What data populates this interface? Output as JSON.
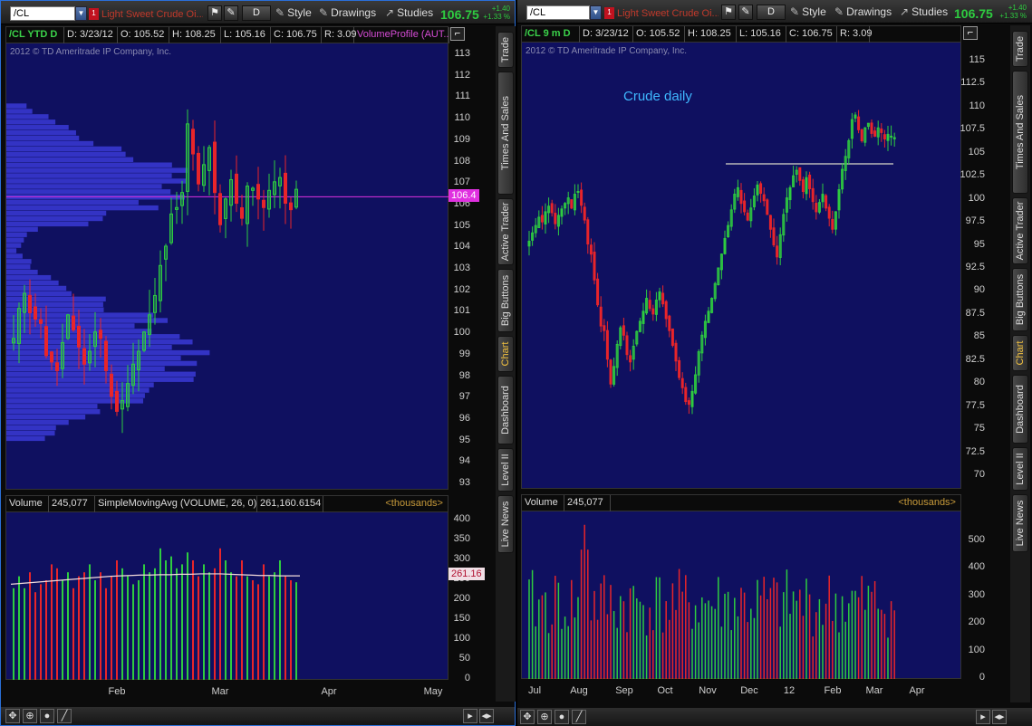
{
  "left": {
    "toolbar": {
      "symbol": "/CL",
      "description": "Light Sweet Crude Oi...",
      "badge": "1",
      "aggregation": "D",
      "style_label": "Style",
      "drawings_label": "Drawings",
      "studies_label": "Studies",
      "last_price": "106.75",
      "change_abs": "+1.40",
      "change_pct": "+1.33 %"
    },
    "header": {
      "symbol_tf": "/CL YTD D",
      "date": "D: 3/23/12",
      "open": "O: 105.52",
      "high": "H: 108.25",
      "low": "L: 105.16",
      "close": "C: 106.75",
      "range": "R: 3.09",
      "study": "VolumeProfile (AUT..."
    },
    "copyright": "2012 © TD Ameritrade IP Company, Inc.",
    "price_axis": [
      "113",
      "112",
      "111",
      "110",
      "109",
      "108",
      "107",
      "106",
      "105",
      "104",
      "103",
      "102",
      "101",
      "100",
      "99",
      "98",
      "97",
      "96",
      "95",
      "94",
      "93"
    ],
    "price_tag": "106.4",
    "volume_header": {
      "label": "Volume",
      "value": "245,077",
      "study": "SimpleMovingAvg (VOLUME, 26, 0)",
      "study_value": "261,160.6154",
      "units": "<thousands>"
    },
    "volume_axis": [
      "400",
      "350",
      "300",
      "250",
      "200",
      "150",
      "100",
      "50",
      "0"
    ],
    "volume_tag": "261.16",
    "time_axis": [
      "Feb",
      "Mar",
      "Apr",
      "May"
    ]
  },
  "right": {
    "toolbar": {
      "symbol": "/CL",
      "description": "Light Sweet Crude Oi...",
      "badge": "1",
      "aggregation": "D",
      "style_label": "Style",
      "drawings_label": "Drawings",
      "studies_label": "Studies",
      "last_price": "106.75",
      "change_abs": "+1.40",
      "change_pct": "+1.33 %"
    },
    "header": {
      "symbol_tf": "/CL 9 m D",
      "date": "D: 3/23/12",
      "open": "O: 105.52",
      "high": "H: 108.25",
      "low": "L: 105.16",
      "close": "C: 106.75",
      "range": "R: 3.09"
    },
    "copyright": "2012 © TD Ameritrade IP Company, Inc.",
    "annotation": "Crude daily",
    "price_axis": [
      "115",
      "112.5",
      "110",
      "107.5",
      "105",
      "102.5",
      "100",
      "97.5",
      "95",
      "92.5",
      "90",
      "87.5",
      "85",
      "82.5",
      "80",
      "77.5",
      "75",
      "72.5",
      "70"
    ],
    "volume_header": {
      "label": "Volume",
      "value": "245,077",
      "units": "<thousands>"
    },
    "volume_axis": [
      "500",
      "400",
      "300",
      "200",
      "100",
      "0"
    ],
    "time_axis": [
      "Jul",
      "Aug",
      "Sep",
      "Oct",
      "Nov",
      "Dec",
      "12",
      "Feb",
      "Mar",
      "Apr"
    ]
  },
  "side_tabs": [
    "Trade",
    "Times And Sales",
    "Active Trader",
    "Big Buttons",
    "Chart",
    "Dashboard",
    "Level II",
    "Live News"
  ],
  "active_tab": "Chart",
  "colors": {
    "chart_bg": "#0f1060",
    "up": "#2ecc40",
    "down": "#e8252a",
    "profile": "#3a3ad6",
    "poc_line": "#e030e0",
    "sma_line": "#f3dada",
    "resistance_line": "#b8b8b8"
  },
  "chart_data": [
    {
      "type": "candlestick",
      "title": "/CL YTD D",
      "ylim": [
        93,
        113.5
      ],
      "x_range": [
        "2012-01-03",
        "2012-05-25"
      ],
      "poc_price": 106.4,
      "closes": [
        99.8,
        101.2,
        101.9,
        101.0,
        100.7,
        100.5,
        99.0,
        98.7,
        98.3,
        99.6,
        100.9,
        100.2,
        99.4,
        98.6,
        99.2,
        100.1,
        99.8,
        98.3,
        97.1,
        96.4,
        96.9,
        97.7,
        98.6,
        99.2,
        100.1,
        100.9,
        101.8,
        103.2,
        104.1,
        105.6,
        105.9,
        106.6,
        109.8,
        108.4,
        107.0,
        107.9,
        108.7,
        106.6,
        105.1,
        106.3,
        107.2,
        106.1,
        105.4,
        106.9,
        106.8,
        106.3,
        105.9,
        106.7,
        107.1,
        107.3,
        106.1,
        105.8,
        106.75
      ],
      "volume_thousands": [
        230,
        260,
        230,
        270,
        220,
        240,
        250,
        290,
        280,
        250,
        270,
        230,
        260,
        270,
        290,
        250,
        270,
        230,
        260,
        300,
        280,
        260,
        240,
        250,
        290,
        270,
        280,
        330,
        300,
        310,
        280,
        290,
        320,
        300,
        260,
        290,
        270,
        280,
        330,
        300,
        270,
        260,
        300,
        260,
        250,
        240,
        290,
        260,
        270,
        300,
        260,
        250,
        245
      ],
      "sma_26_thousands": [
        240,
        242,
        244,
        246,
        248,
        250,
        252,
        254,
        256,
        258,
        260,
        261,
        262,
        263,
        263,
        264,
        264,
        265,
        265,
        266,
        266,
        266,
        265,
        264,
        263,
        262,
        262,
        261,
        261,
        261
      ]
    },
    {
      "type": "candlestick",
      "title": "/CL 9 m D",
      "annotation": "Crude daily",
      "ylim": [
        68.5,
        116.5
      ],
      "x_range": [
        "2011-06-27",
        "2012-04-20"
      ],
      "resistance": 103.9,
      "closes": [
        95.5,
        96.4,
        97.2,
        98.1,
        97.6,
        98.7,
        99.3,
        98.6,
        97.4,
        98.3,
        99.0,
        99.6,
        100.2,
        99.1,
        100.6,
        100.9,
        99.4,
        97.8,
        95.2,
        94.1,
        91.3,
        88.6,
        86.3,
        85.8,
        82.7,
        80.0,
        81.9,
        84.3,
        86.1,
        85.3,
        83.2,
        82.4,
        84.1,
        85.7,
        86.8,
        87.9,
        89.3,
        88.2,
        87.6,
        89.1,
        90.0,
        88.7,
        87.1,
        85.8,
        84.2,
        82.5,
        80.7,
        79.6,
        78.1,
        77.8,
        79.2,
        81.0,
        83.5,
        85.3,
        86.8,
        87.9,
        89.3,
        90.9,
        92.6,
        94.1,
        95.8,
        97.2,
        98.9,
        100.6,
        101.3,
        99.6,
        98.7,
        97.8,
        99.1,
        100.4,
        101.6,
        100.7,
        99.9,
        98.4,
        96.8,
        95.1,
        93.8,
        96.2,
        98.4,
        100.2,
        101.3,
        102.6,
        103.2,
        102.1,
        100.9,
        102.4,
        101.2,
        99.8,
        98.7,
        99.7,
        100.6,
        99.1,
        98.0,
        96.8,
        98.7,
        101.1,
        103.3,
        104.7,
        106.4,
        108.7,
        109.2,
        107.6,
        106.4,
        107.8,
        108.3,
        107.2,
        106.9,
        107.8,
        107.3,
        106.6,
        107.1,
        106.9,
        106.75
      ],
      "volume_max_thousands": 580,
      "volume_typical_thousands": [
        150,
        400
      ]
    }
  ]
}
